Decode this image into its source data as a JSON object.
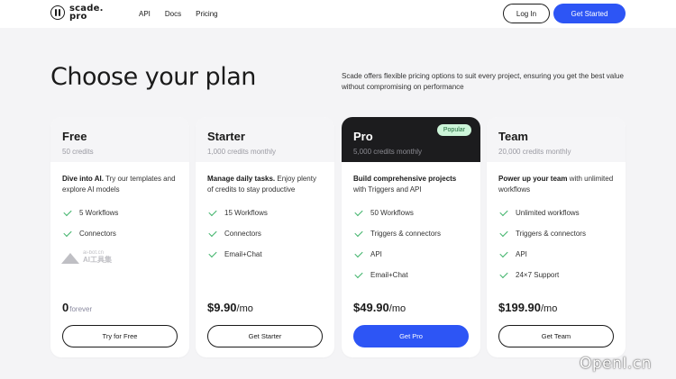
{
  "header": {
    "logo_line1": "scade.",
    "logo_line2": "pro",
    "nav": [
      "API",
      "Docs",
      "Pricing"
    ],
    "login_label": "Log In",
    "get_started_label": "Get Started"
  },
  "hero": {
    "title": "Choose your plan",
    "description": "Scade offers flexible pricing options to suit every project, ensuring you get the best value without compromising on performance"
  },
  "plans": [
    {
      "name": "Free",
      "credits": "50 credits",
      "tagline_bold": "Dive into AI.",
      "tagline_rest": " Try our templates and explore AI models",
      "features": [
        "5 Workflows",
        "Connectors"
      ],
      "price": "0",
      "price_suffix": "forever",
      "cta": "Try for Free"
    },
    {
      "name": "Starter",
      "credits": "1,000 credits monthly",
      "tagline_bold": "Manage daily tasks.",
      "tagline_rest": " Enjoy plenty of credits to stay productive",
      "features": [
        "15 Workflows",
        "Connectors",
        "Email+Chat"
      ],
      "price": "$9.90",
      "price_suffix": "/mo",
      "cta": "Get Starter"
    },
    {
      "name": "Pro",
      "badge": "Popular",
      "credits": "5,000 credits monthly",
      "tagline_bold": "Build comprehensive projects",
      "tagline_rest": " with Triggers and API",
      "features": [
        "50 Workflows",
        "Triggers & connectors",
        "API",
        "Email+Chat"
      ],
      "price": "$49.90",
      "price_suffix": "/mo",
      "cta": "Get Pro"
    },
    {
      "name": "Team",
      "credits": "20,000 credits monthly",
      "tagline_bold": "Power up your team",
      "tagline_rest": " with unlimited workflows",
      "features": [
        "Unlimited workflows",
        "Triggers & connectors",
        "API",
        "24×7 Support"
      ],
      "price": "$199.90",
      "price_suffix": "/mo",
      "cta": "Get Team"
    }
  ],
  "watermarks": {
    "card_wm_small": "ai-bot.cn",
    "card_wm_large": "AI工具集",
    "corner": "OpenI.cn"
  },
  "colors": {
    "accent": "#2d55f5",
    "check": "#3fb36a",
    "badge_bg": "#cdf5d9",
    "pro_header": "#1c1c1e"
  }
}
